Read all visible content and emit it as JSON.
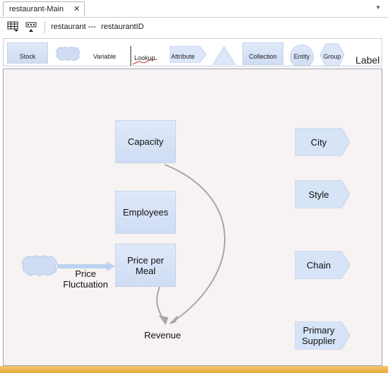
{
  "tab": {
    "title": "restaurant-Main",
    "close_symbol": "✕"
  },
  "toolbar": {
    "table_icon": "table-grid-icon",
    "keyboard_icon": "keyboard-icon",
    "entity_name": "restaurant ---",
    "entity_id": "restaurantID"
  },
  "palette": {
    "items": [
      {
        "label": "Stock"
      },
      {
        "label": ""
      },
      {
        "label": "Variable"
      },
      {
        "label": "Lookup"
      },
      {
        "label": "Attribute"
      },
      {
        "label": ""
      },
      {
        "label": "Collection"
      },
      {
        "label": "Entity"
      },
      {
        "label": "Group"
      },
      {
        "label": "Label"
      }
    ]
  },
  "canvas": {
    "stocks": [
      {
        "label": "Capacity"
      },
      {
        "label": "Employees"
      },
      {
        "label": "Price per\nMeal"
      }
    ],
    "attributes": [
      {
        "label": "City"
      },
      {
        "label": "Style"
      },
      {
        "label": "Chain"
      },
      {
        "label": "Primary\nSupplier"
      }
    ],
    "flow_label": "Price\nFluctuation",
    "variable_label": "Revenue"
  },
  "colors": {
    "stock_fill": "#d5e2f7",
    "link_gray": "#a6a6a6",
    "flow_blue": "#bcd3f2",
    "canvas_bg": "#f7f3f2",
    "status_bar": "#f0b850"
  }
}
